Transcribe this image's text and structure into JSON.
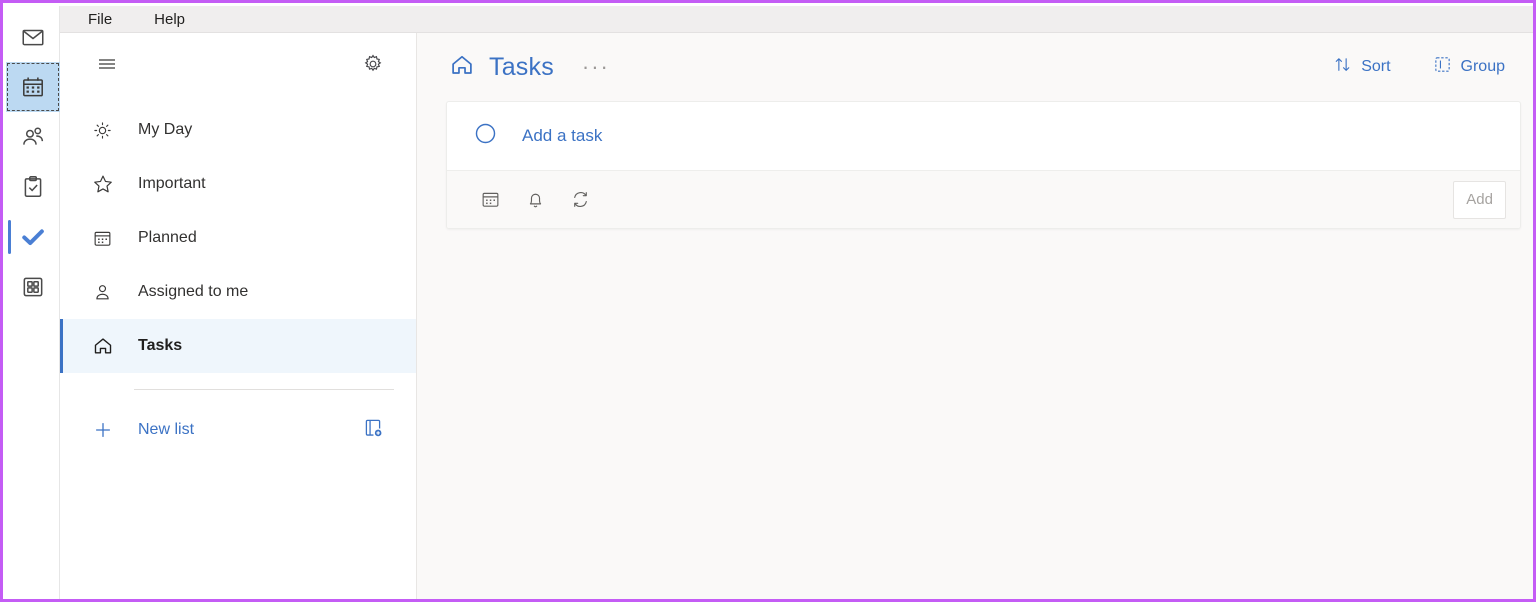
{
  "app_rail": {
    "items": [
      {
        "name": "mail",
        "icon": "mail-icon",
        "state": "normal"
      },
      {
        "name": "calendar",
        "icon": "calendar-icon",
        "state": "selected"
      },
      {
        "name": "people",
        "icon": "people-icon",
        "state": "normal"
      },
      {
        "name": "tasks-board",
        "icon": "clipboard-check-icon",
        "state": "normal"
      },
      {
        "name": "to-do",
        "icon": "checkmark-icon",
        "state": "active"
      },
      {
        "name": "more-apps",
        "icon": "apps-grid-icon",
        "state": "normal"
      }
    ]
  },
  "menubar": {
    "items": [
      {
        "label": "File"
      },
      {
        "label": "Help"
      }
    ]
  },
  "sidebar": {
    "hamburger_icon": "hamburger-menu-icon",
    "settings_icon": "gear-icon",
    "items": [
      {
        "label": "My Day",
        "icon": "sun-icon",
        "selected": false
      },
      {
        "label": "Important",
        "icon": "star-icon",
        "selected": false
      },
      {
        "label": "Planned",
        "icon": "calendar-icon",
        "selected": false
      },
      {
        "label": "Assigned to me",
        "icon": "person-icon",
        "selected": false
      },
      {
        "label": "Tasks",
        "icon": "home-icon",
        "selected": true
      }
    ],
    "new_list": {
      "label": "New list",
      "plus_icon": "plus-icon",
      "new_group_icon": "new-group-icon"
    }
  },
  "content": {
    "title": "Tasks",
    "title_icon": "home-icon",
    "more_options_label": "···",
    "actions": [
      {
        "label": "Sort",
        "icon": "sort-arrows-icon"
      },
      {
        "label": "Group",
        "icon": "group-box-icon"
      }
    ],
    "add_task": {
      "placeholder": "Add a task",
      "circle_icon": "circle-icon",
      "meta_icons": [
        {
          "name": "due-date-icon"
        },
        {
          "name": "reminder-bell-icon"
        },
        {
          "name": "repeat-icon"
        }
      ],
      "add_button_label": "Add"
    }
  },
  "colors": {
    "accent_blue": "#3b72c4",
    "rail_selected": "#bcd9f2",
    "nav_selected_bg": "#eff6fc",
    "content_bg": "#faf9f8",
    "frame_border": "#c45cf5"
  }
}
